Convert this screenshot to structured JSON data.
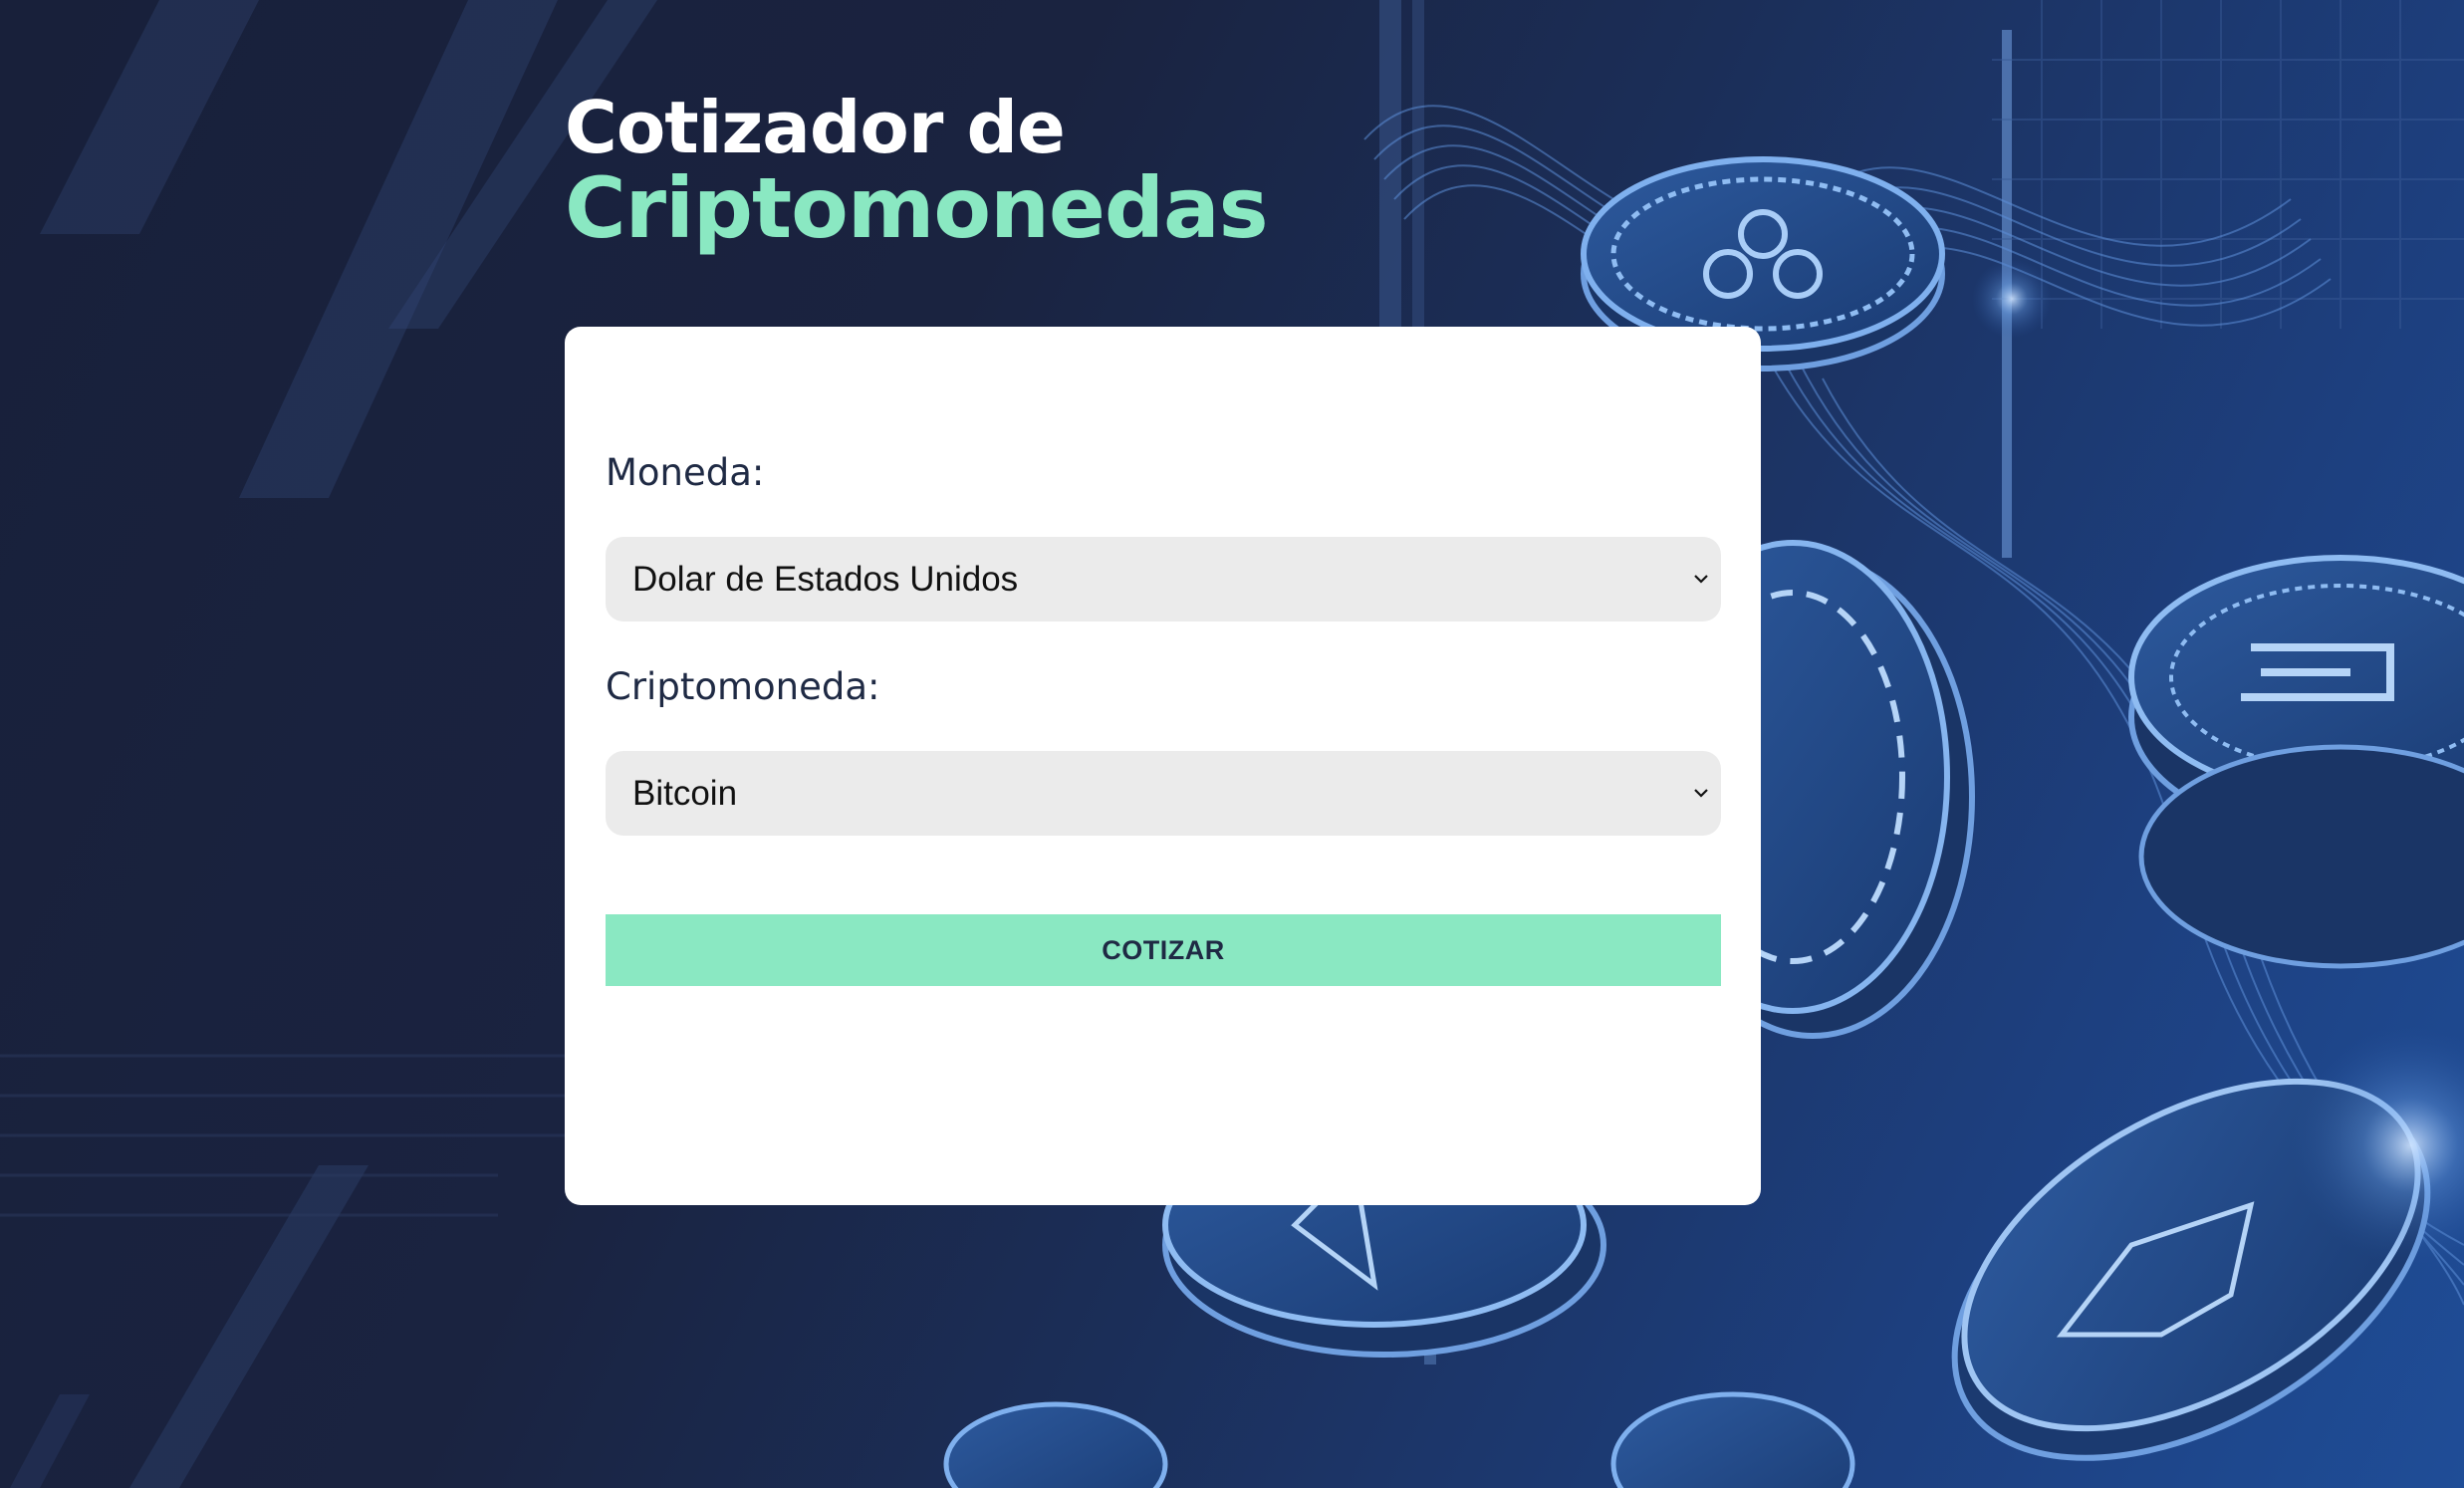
{
  "header": {
    "title_line1": "Cotizador de",
    "title_line2": "Criptomonedas"
  },
  "form": {
    "currency_label": "Moneda:",
    "currency_value": "Dolar de Estados Unidos",
    "crypto_label": "Criptomoneda:",
    "crypto_value": "Bitcoin",
    "submit_label": "COTIZAR"
  },
  "colors": {
    "accent": "#8ae8c2",
    "background": "#18203a",
    "card": "#ffffff",
    "select_bg": "#ebebeb"
  },
  "icons": {
    "select_arrow": "chevron-down-icon",
    "background_image": "crypto-coins-background"
  }
}
